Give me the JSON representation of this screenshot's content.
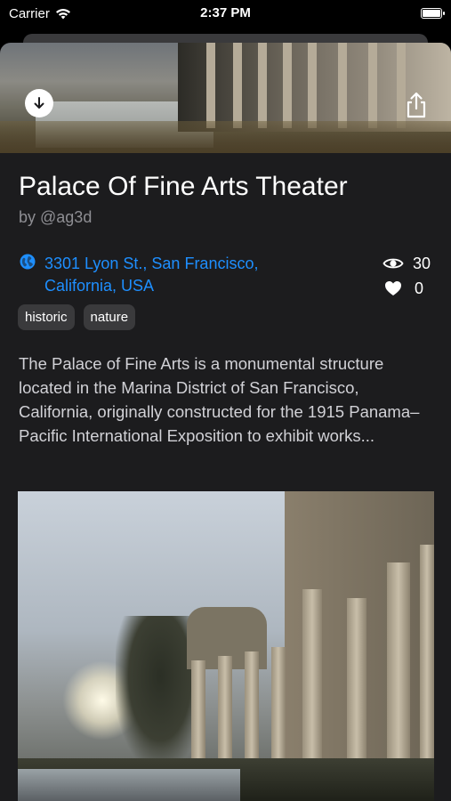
{
  "status_bar": {
    "carrier": "Carrier",
    "time": "2:37 PM"
  },
  "place": {
    "title": "Palace Of Fine Arts Theater",
    "author": "by @ag3d",
    "address": "3301 Lyon St., San Francisco, California, USA",
    "views": "30",
    "likes": "0",
    "tags": [
      "historic",
      "nature"
    ],
    "description": "The Palace of Fine Arts is a monumental structure located in the Marina District of San Francisco, California, originally constructed for the 1915 Panama–Pacific International Exposition to exhibit works..."
  },
  "colors": {
    "background": "#1c1c1e",
    "link": "#1e8fff",
    "secondary_text": "#8e8e93",
    "tag_background": "#3a3a3c"
  },
  "icons": {
    "download": "download-icon",
    "share": "share-icon",
    "globe": "globe-icon",
    "views": "eye-icon",
    "likes": "heart-icon"
  }
}
